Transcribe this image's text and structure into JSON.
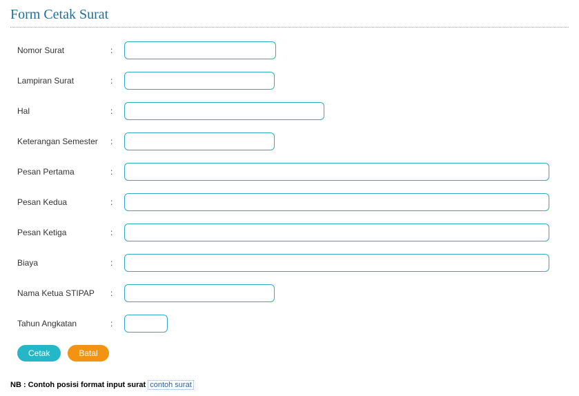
{
  "title": "Form Cetak Surat",
  "fields": {
    "nomor_surat": {
      "label": "Nomor Surat",
      "value": ""
    },
    "lampiran": {
      "label": "Lampiran Surat",
      "value": ""
    },
    "hal": {
      "label": "Hal",
      "value": ""
    },
    "ket_semester": {
      "label": "Keterangan Semester",
      "value": ""
    },
    "pesan1": {
      "label": "Pesan Pertama",
      "value": ""
    },
    "pesan2": {
      "label": "Pesan Kedua",
      "value": ""
    },
    "pesan3": {
      "label": "Pesan Ketiga",
      "value": ""
    },
    "biaya": {
      "label": "Biaya",
      "value": ""
    },
    "ketua": {
      "label": "Nama Ketua STIPAP",
      "value": ""
    },
    "tahun": {
      "label": "Tahun Angkatan",
      "value": ""
    }
  },
  "buttons": {
    "cetak": "Cetak",
    "batal": "Batal"
  },
  "note": {
    "prefix": "NB : Contoh posisi format input surat ",
    "link_text": "contoh surat"
  }
}
